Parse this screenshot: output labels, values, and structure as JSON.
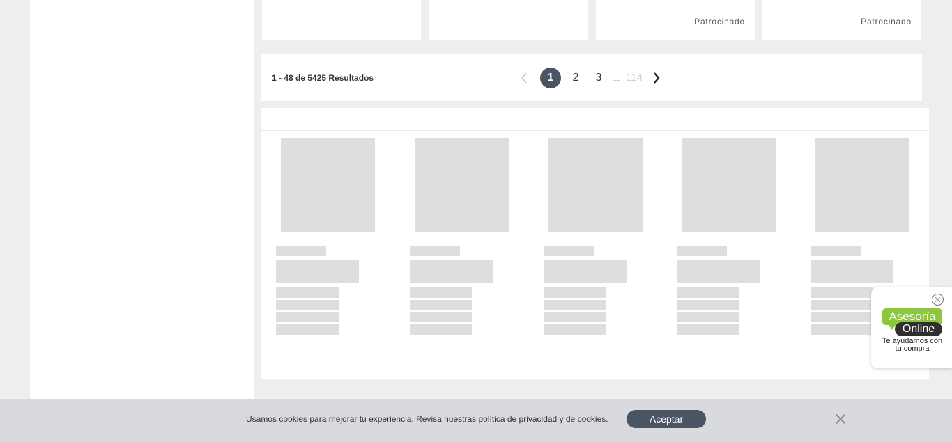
{
  "product_cards": [
    {
      "sponsored_label": ""
    },
    {
      "sponsored_label": ""
    },
    {
      "sponsored_label": "Patrocinado"
    },
    {
      "sponsored_label": "Patrocinado"
    }
  ],
  "pagination": {
    "results_text": "1 - 48 de 5425 Resultados",
    "pages": [
      "1",
      "2",
      "3"
    ],
    "ellipsis": "...",
    "last_page": "114",
    "current_page": "1",
    "prev_icon": "chevron-left-icon",
    "next_icon": "chevron-right-icon"
  },
  "chat_widget": {
    "badge_top": "Asesoría",
    "badge_bottom": "Online",
    "subtitle": "Te ayudamos con tu compra",
    "colors": {
      "green": "#8dc63f",
      "dark": "#2f2f2f"
    }
  },
  "cookie_banner": {
    "text_before": "Usamos cookies para mejorar tu experiencia. Revisa nuestras ",
    "privacy_link": "política de privacidad",
    "text_middle": " y de ",
    "cookies_link": "cookies",
    "text_after": ".",
    "accept_label": "Aceptar",
    "close_icon": "close-icon"
  },
  "theme": {
    "accent": "#4a5462",
    "background": "#eeeeee",
    "skeleton": "#dedede"
  }
}
